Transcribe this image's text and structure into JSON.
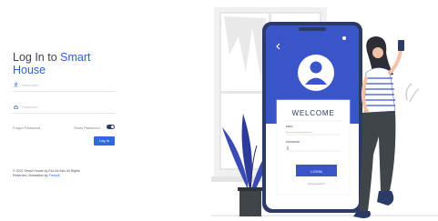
{
  "login": {
    "title_line1_prefix": "Log In to ",
    "title_line1_accent": "Smart",
    "title_line2_accent": "House",
    "username_placeholder": "Username",
    "password_placeholder": "Password",
    "forgot_password": "Forgot Password",
    "show_password": "Show Password",
    "login_button": "Log In",
    "footer_line1": "© 2022 Smart House by Eko Ali Aziz All Rights",
    "footer_line2_prefix": "Reserved. Illustration by ",
    "footer_line2_link": "Freepik"
  },
  "illustration": {
    "welcome": "WELCOME",
    "email_label": "EMAIL",
    "email_value": "boy.smart.house@email.com",
    "password_label": "PASSWORD",
    "login_label": "LOGIN",
    "forgot_label": "Forgot password?"
  },
  "colors": {
    "accent": "#2f5fd0",
    "phone_blue": "#3a55c9",
    "dark_navy": "#2b3a67",
    "plant_blue": "#3b4bb5"
  },
  "icons": [
    "user-icon",
    "lock-icon",
    "back-arrow-icon",
    "avatar-icon"
  ]
}
